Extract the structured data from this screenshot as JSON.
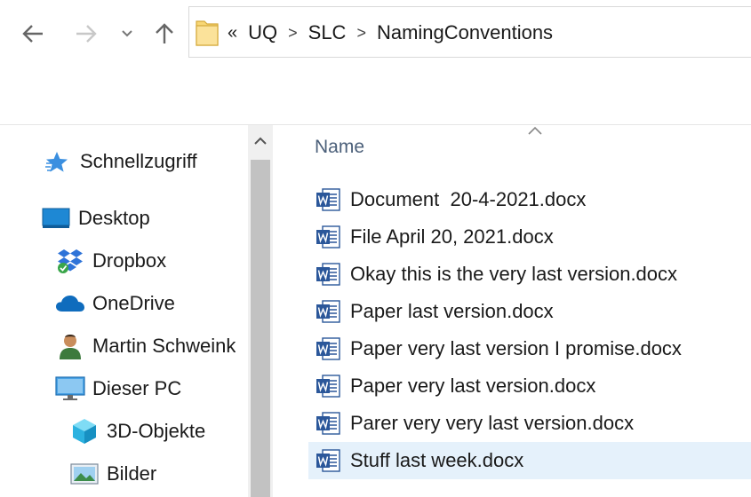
{
  "address_bar": {
    "overflow_label": "«",
    "crumbs": [
      "UQ",
      "SLC",
      "NamingConventions"
    ],
    "separator": ">"
  },
  "nav_pane": {
    "items": [
      {
        "label": "Schnellzugriff",
        "icon": "quick-access-star-icon"
      },
      {
        "label": "Desktop",
        "icon": "desktop-icon"
      },
      {
        "label": "Dropbox",
        "icon": "dropbox-icon"
      },
      {
        "label": "OneDrive",
        "icon": "onedrive-cloud-icon"
      },
      {
        "label": "Martin Schweink",
        "icon": "user-folder-icon"
      },
      {
        "label": "Dieser PC",
        "icon": "this-pc-icon"
      },
      {
        "label": "3D-Objekte",
        "icon": "3d-objects-icon"
      },
      {
        "label": "Bilder",
        "icon": "pictures-icon"
      }
    ]
  },
  "file_list": {
    "column_name": "Name",
    "files": [
      "Document  20-4-2021.docx",
      "File April 20, 2021.docx",
      "Okay this is the very last version.docx",
      "Paper last version.docx",
      "Paper very last version I promise.docx",
      "Paper very last version.docx",
      "Parer very very last version.docx",
      "Stuff last week.docx"
    ],
    "selected_index": 7
  },
  "colors": {
    "selection": "#e5f1fb",
    "word_blue": "#2b579a",
    "folder_yellow": "#f8d775",
    "header_text": "#4c607a"
  }
}
